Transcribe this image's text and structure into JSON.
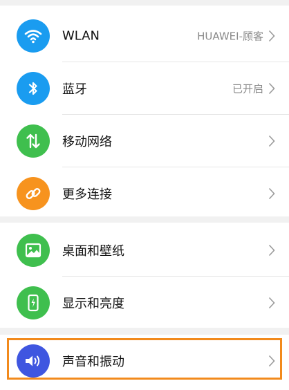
{
  "colors": {
    "wifi": "#1a9cf0",
    "bluetooth": "#1a9cf0",
    "mobile_network": "#3fbf4e",
    "more_connections": "#f7931e",
    "wallpaper": "#3fbf4e",
    "display": "#3fbf4e",
    "sound": "#3f56e0",
    "highlight_border": "#f28a1c"
  },
  "groups": [
    {
      "items": [
        {
          "label": "WLAN",
          "value": "HUAWEI-顾客",
          "icon": "wifi-icon"
        },
        {
          "label": "蓝牙",
          "value": "已开启",
          "icon": "bluetooth-icon"
        },
        {
          "label": "移动网络",
          "value": "",
          "icon": "mobile-data-icon"
        },
        {
          "label": "更多连接",
          "value": "",
          "icon": "link-icon"
        }
      ]
    },
    {
      "items": [
        {
          "label": "桌面和壁纸",
          "value": "",
          "icon": "image-icon"
        },
        {
          "label": "显示和亮度",
          "value": "",
          "icon": "phone-brightness-icon"
        }
      ]
    },
    {
      "items": [
        {
          "label": "声音和振动",
          "value": "",
          "icon": "speaker-icon"
        }
      ]
    }
  ]
}
